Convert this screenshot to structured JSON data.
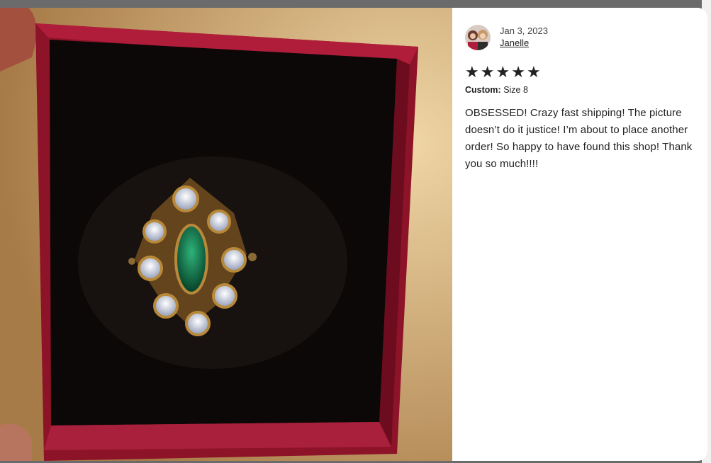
{
  "review": {
    "date": "Jan 3, 2023",
    "reviewer_name": "Janelle",
    "rating": 5,
    "stars": [
      "★",
      "★",
      "★",
      "★",
      "★"
    ],
    "custom_label": "Custom:",
    "custom_value": "Size 8",
    "text": "OBSESSED! Crazy fast shipping! The picture doesn’t do it justice! I’m about to place another order! So happy to have found this shop! Thank you so much!!!!"
  },
  "colors": {
    "box_red": "#9c1630",
    "velvet": "#0b0807",
    "emerald": "#0f6b45",
    "gold": "#b8893a",
    "text": "#222222"
  },
  "icons": [
    "avatar-photo",
    "star-icon"
  ]
}
